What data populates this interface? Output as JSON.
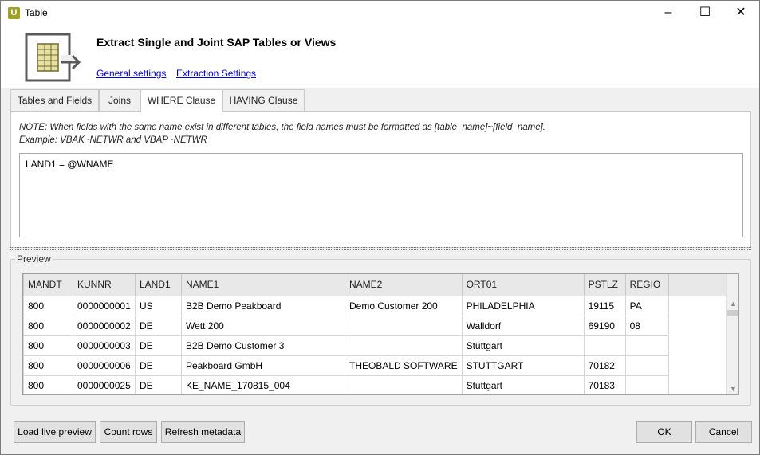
{
  "window": {
    "title": "Table",
    "app_icon_letter": "U"
  },
  "header": {
    "title": "Extract Single and Joint SAP Tables or Views",
    "links": {
      "general": "General settings",
      "extraction": "Extraction Settings"
    }
  },
  "tabs": [
    {
      "label": "Tables and Fields"
    },
    {
      "label": "Joins"
    },
    {
      "label": "WHERE Clause"
    },
    {
      "label": "HAVING Clause"
    }
  ],
  "where": {
    "note_line1": "NOTE: When fields with the same name exist in different tables, the field names must be formatted as [table_name]~[field_name].",
    "note_line2": "Example: VBAK~NETWR and VBAP~NETWR",
    "clause": "LAND1 = @WNAME"
  },
  "preview": {
    "legend": "Preview",
    "columns": [
      "MANDT",
      "KUNNR",
      "LAND1",
      "NAME1",
      "NAME2",
      "ORT01",
      "PSTLZ",
      "REGIO"
    ],
    "rows": [
      [
        "800",
        "0000000001",
        "US",
        "B2B Demo Peakboard",
        "Demo Customer 200",
        "PHILADELPHIA",
        "19115",
        "PA"
      ],
      [
        "800",
        "0000000002",
        "DE",
        "Wett 200",
        "",
        "Walldorf",
        "69190",
        "08"
      ],
      [
        "800",
        "0000000003",
        "DE",
        "B2B Demo Customer 3",
        "",
        "Stuttgart",
        "",
        ""
      ],
      [
        "800",
        "0000000006",
        "DE",
        "Peakboard GmbH",
        "THEOBALD SOFTWARE",
        "STUTTGART",
        "70182",
        ""
      ],
      [
        "800",
        "0000000025",
        "DE",
        "KE_NAME_170815_004",
        "",
        "Stuttgart",
        "70183",
        ""
      ]
    ]
  },
  "buttons": {
    "load_preview": "Load live preview",
    "count_rows": "Count rows",
    "refresh_metadata": "Refresh metadata",
    "ok": "OK",
    "cancel": "Cancel"
  }
}
